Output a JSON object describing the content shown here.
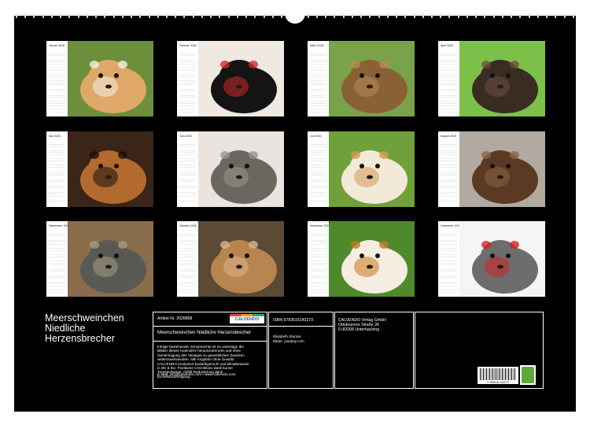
{
  "months": [
    {
      "name": "Januar 2026",
      "photo": "guinea-pig-cream-white",
      "colors": [
        "#6b8f3a",
        "#e0a868",
        "#f4efe6"
      ]
    },
    {
      "name": "Februar 2026",
      "photo": "guinea-pig-black",
      "colors": [
        "#efe9e2",
        "#141414",
        "#d02a2a"
      ]
    },
    {
      "name": "März 2026",
      "photo": "guinea-pig-agouti",
      "colors": [
        "#7aa24a",
        "#8a6134",
        "#b5895a"
      ]
    },
    {
      "name": "April 2026",
      "photo": "guinea-pig-dark-brown",
      "colors": [
        "#7cc04a",
        "#3a2c22",
        "#6c5040"
      ]
    },
    {
      "name": "Mai 2026",
      "photo": "guinea-pig-tortoiseshell",
      "colors": [
        "#3b2418",
        "#b26a2e",
        "#1a120d"
      ]
    },
    {
      "name": "Juni 2026",
      "photo": "guinea-pig-grey-agouti",
      "colors": [
        "#e9e4df",
        "#6b6660",
        "#9a938b"
      ]
    },
    {
      "name": "Juli 2026",
      "photo": "guinea-pig-cream-white-grass",
      "colors": [
        "#6fa03a",
        "#f3e9d8",
        "#cf9a5a"
      ]
    },
    {
      "name": "August 2026",
      "photo": "guinea-pig-brown",
      "colors": [
        "#b2a9a0",
        "#5a3a22",
        "#8d6445"
      ]
    },
    {
      "name": "September 2026",
      "photo": "guinea-pig-grey-wood",
      "colors": [
        "#8a6d4a",
        "#5a5a55",
        "#a59b86"
      ]
    },
    {
      "name": "Oktober 2026",
      "photo": "guinea-pig-golden",
      "colors": [
        "#5c4a36",
        "#b78650",
        "#dab38a"
      ]
    },
    {
      "name": "November 2026",
      "photo": "guinea-pig-tricolor-flower",
      "colors": [
        "#4f8a2a",
        "#f5ede2",
        "#c8781e"
      ]
    },
    {
      "name": "Dezember 2026",
      "photo": "guinea-pig-grey-red-box",
      "colors": [
        "#f5f5f5",
        "#6d6d6d",
        "#d62020"
      ]
    }
  ],
  "title": [
    "Meerschweinchen",
    "Niedliche",
    "Herzensbrecher"
  ],
  "info": {
    "article": "Artikel-Nr. 2028868",
    "logo": "CALVENDO",
    "product_title": "Meerschweinchen Niedliche Herzensbrecher",
    "notice": "Infolge bestehender Schutzrechte ist es untersagt, die Blätter dieses Kalenders herauszutrennen und ohne Genehmigung des Verlages zu gewerblichen Zwecken weiterzuverwenden. Alle Angaben ohne Gewähr. CALVENDO produziert bedarfsgerecht und klimabewusst in DE & EU. Positivere CO2-Bilanz dank kurzer Transportwege. Abfall-Reduzierung dank Einzelstückfertigung.",
    "contact": "E-Mail: info@calvendo.com • www.calvendo.com",
    "isbn": "ISBN 9783516142273",
    "author": "Elisabeth Stanzer",
    "images": "Bilder: pixabay.com",
    "publisher": [
      "CALVENDO Verlag GmbH",
      "Ottobrunner Straße 39",
      "D-82008 Unterhaching"
    ],
    "barcode_number": "9 783516 142273"
  }
}
